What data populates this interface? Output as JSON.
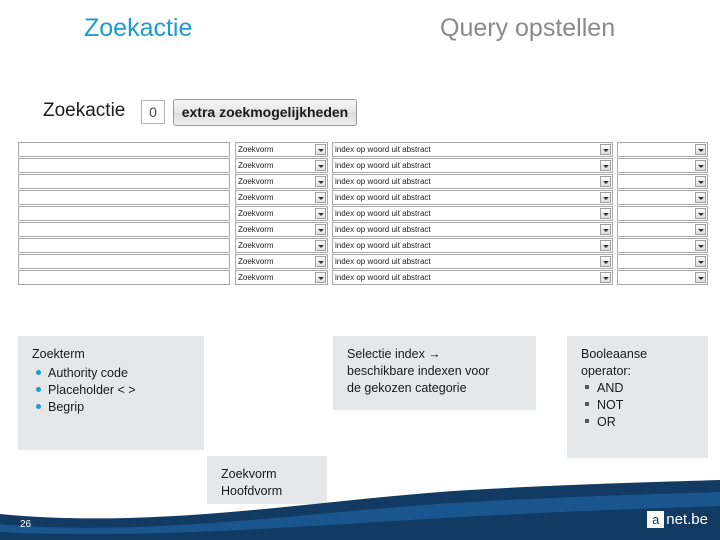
{
  "header": {
    "title_left": "Zoekactie",
    "title_right": "Query opstellen"
  },
  "screenshot": {
    "panel_title": "Zoekactie",
    "count_value": "0",
    "extra_button_label": "extra zoekmogelijkheden",
    "rows": [
      {
        "keyword": "",
        "form": "Zoekvorm",
        "index": "index op woord uit abstract",
        "boolean": ""
      },
      {
        "keyword": "",
        "form": "Zoekvorm",
        "index": "index op woord uit abstract",
        "boolean": ""
      },
      {
        "keyword": "",
        "form": "Zoekvorm",
        "index": "index op woord uit abstract",
        "boolean": ""
      },
      {
        "keyword": "",
        "form": "Zoekvorm",
        "index": "index op woord uit abstract",
        "boolean": ""
      },
      {
        "keyword": "",
        "form": "Zoekvorm",
        "index": "index op woord uit abstract",
        "boolean": ""
      },
      {
        "keyword": "",
        "form": "Zoekvorm",
        "index": "index op woord uit abstract",
        "boolean": ""
      },
      {
        "keyword": "",
        "form": "Zoekvorm",
        "index": "index op woord uit abstract",
        "boolean": ""
      },
      {
        "keyword": "",
        "form": "Zoekvorm",
        "index": "index op woord uit abstract",
        "boolean": ""
      },
      {
        "keyword": "",
        "form": "Zoekvorm",
        "index": "index op woord uit abstract",
        "boolean": ""
      }
    ]
  },
  "annotations": {
    "zoekterm": {
      "heading": "Zoekterm",
      "items": [
        "Authority code",
        "Placeholder < >",
        "Begrip"
      ]
    },
    "selectie": {
      "line1": "Selectie index →",
      "line2": "beschikbare indexen voor",
      "line3": "de gekozen categorie"
    },
    "boolean": {
      "line1": "Booleaanse",
      "line2": "operator:",
      "items": [
        "AND",
        "NOT",
        "OR"
      ]
    },
    "zoekvorm": {
      "line1": "Zoekvorm",
      "line2": "Hoofdvorm"
    }
  },
  "footer": {
    "slide_number": "26",
    "brand_letter": "a",
    "brand_text": "net.be"
  },
  "colors": {
    "accent_blue": "#1b9ad6",
    "title_grey": "#8a8a8a",
    "panel_grey": "#e6e7e8",
    "footer_navy": "#123a63"
  }
}
